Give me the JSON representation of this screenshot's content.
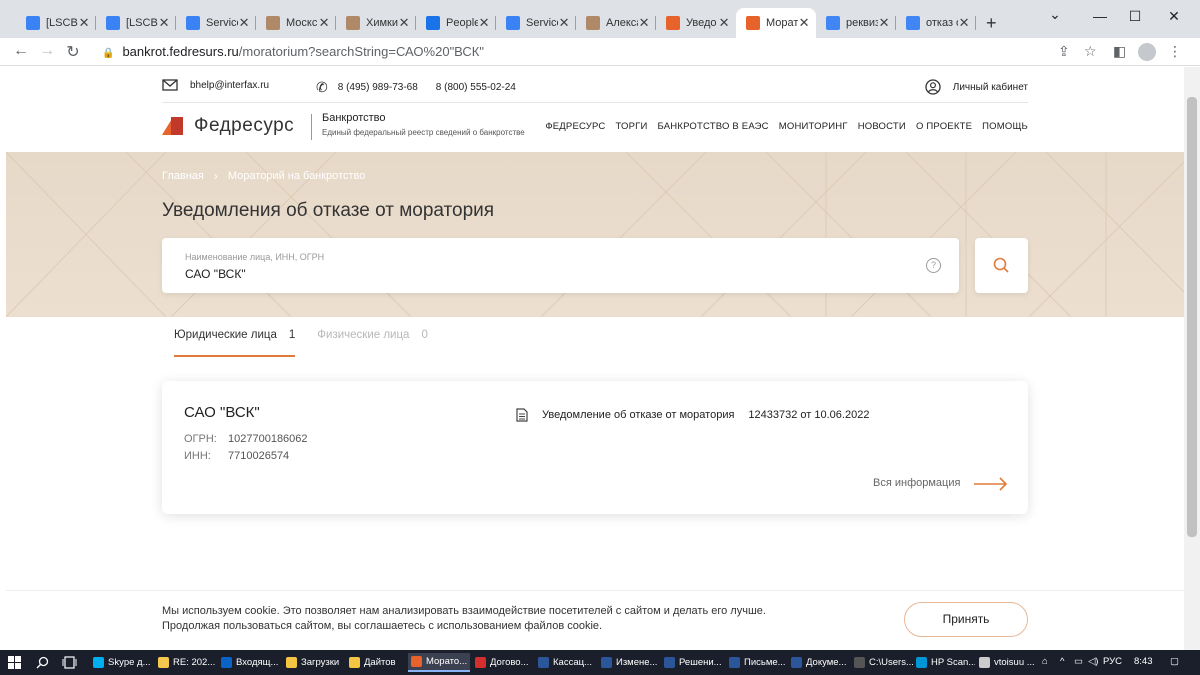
{
  "browser": {
    "tabs": [
      {
        "label": "[LSCBU",
        "color": "#3b82f6"
      },
      {
        "label": "[LSCBU",
        "color": "#3b82f6"
      },
      {
        "label": "Service",
        "color": "#3b82f6"
      },
      {
        "label": "Москс",
        "color": "#b08968"
      },
      {
        "label": "Химкин",
        "color": "#b08968"
      },
      {
        "label": "People",
        "color": "#1a73e8"
      },
      {
        "label": "Service",
        "color": "#3b82f6"
      },
      {
        "label": "Алекса",
        "color": "#b08968"
      },
      {
        "label": "Уведо",
        "color": "#e8632b"
      },
      {
        "label": "Морат",
        "color": "#e8632b"
      },
      {
        "label": "реквиз",
        "color": "#4285f4"
      },
      {
        "label": "отказ о",
        "color": "#4285f4"
      }
    ],
    "active_tab": 9,
    "url_host": "bankrot.fedresurs.ru",
    "url_path": "/moratorium?searchString=САО%20\"ВСК\""
  },
  "site": {
    "email": "bhelp@interfax.ru",
    "phone1": "8 (495) 989-73-68",
    "phone2": "8 (800) 555-02-24",
    "cabinet": "Личный кабинет",
    "logo_name": "Федресурс",
    "logo_section": "Банкротство",
    "logo_tagline": "Единый федеральный реестр сведений о банкротстве",
    "nav": [
      "ФЕДРЕСУРС",
      "ТОРГИ",
      "БАНКРОТСТВО В ЕАЭС",
      "МОНИТОРИНГ",
      "НОВОСТИ",
      "О ПРОЕКТЕ",
      "ПОМОЩЬ"
    ]
  },
  "hero": {
    "breadcrumb_home": "Главная",
    "breadcrumb_current": "Мораторий на банкротство",
    "title": "Уведомления об отказе от моратория",
    "search_placeholder": "Наименование лица, ИНН, ОГРН",
    "search_value": "САО \"ВСК\""
  },
  "results": {
    "tabs": [
      {
        "label": "Юридические лица",
        "count": "1",
        "active": true
      },
      {
        "label": "Физические лица",
        "count": "0",
        "active": false
      }
    ],
    "card": {
      "name": "САО \"ВСК\"",
      "ogrn_label": "ОГРН:",
      "ogrn": "1027700186062",
      "inn_label": "ИНН:",
      "inn": "7710026574",
      "notice_label": "Уведомление об отказе от моратория",
      "notice_number": "12433732 от 10.06.2022",
      "more_label": "Вся информация"
    }
  },
  "cookie": {
    "line1": "Мы используем cookie. Это позволяет нам анализировать взаимодействие посетителей с сайтом и делать его лучше.",
    "line2": "Продолжая пользоваться сайтом, вы соглашаетесь с использованием файлов cookie.",
    "accept": "Принять"
  },
  "taskbar": {
    "items": [
      {
        "label": "Skype д...",
        "color": "#00aff0"
      },
      {
        "label": "RE: 202...",
        "color": "#f2c94c"
      },
      {
        "label": "Входящ...",
        "color": "#0a64c8"
      },
      {
        "label": "Загрузки",
        "color": "#f4c542"
      },
      {
        "label": "Дайтов",
        "color": "#f4c542"
      },
      {
        "label": "Морато...",
        "color": "#e8632b"
      },
      {
        "label": "Догово...",
        "color": "#d32f2f"
      },
      {
        "label": "Кассац...",
        "color": "#2b579a"
      },
      {
        "label": "Измене...",
        "color": "#2b579a"
      },
      {
        "label": "Решени...",
        "color": "#2b579a"
      },
      {
        "label": "Письме...",
        "color": "#2b579a"
      },
      {
        "label": "Докуме...",
        "color": "#2b579a"
      },
      {
        "label": "C:\\Users...",
        "color": "#555555"
      },
      {
        "label": "HP Scan...",
        "color": "#0096d6"
      },
      {
        "label": "vtoisuu ...",
        "color": "#cccccc"
      }
    ],
    "active_item": 5,
    "lang": "РУС",
    "time": "8:43"
  },
  "colors": {
    "accent_orange": "#e07b3c",
    "hero_bg": "#e7d9c8",
    "brand_red": "#c0392b"
  }
}
